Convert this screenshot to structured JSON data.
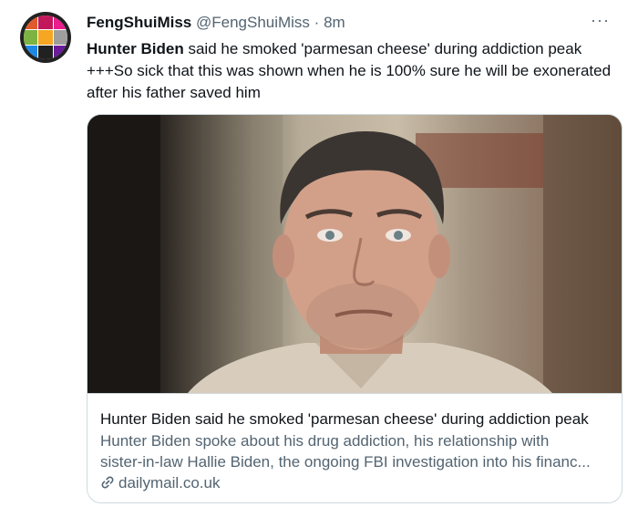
{
  "tweet": {
    "display_name": "FengShuiMiss",
    "handle": "@FengShuiMiss",
    "separator": "·",
    "time": "8m",
    "more_label": "···",
    "text_bold": "Hunter Biden",
    "text_line1_rest": " said he smoked 'parmesan cheese' during addiction peak",
    "text_line2": "+++So sick that this was shown when he is 100% sure he will be exonerated",
    "text_line3": "after his father saved him"
  },
  "card": {
    "title": "Hunter Biden said he smoked 'parmesan cheese' during addiction peak",
    "description_line1": "Hunter Biden spoke about his drug addiction, his relationship with",
    "description_line2": "sister-in-law Hallie Biden, the ongoing FBI investigation into his financ...",
    "domain": "dailymail.co.uk",
    "link_icon": "link-icon",
    "image_alt": "news-photo"
  },
  "colors": {
    "text_primary": "#0f1419",
    "text_secondary": "#536471",
    "border": "#cfd9de"
  }
}
